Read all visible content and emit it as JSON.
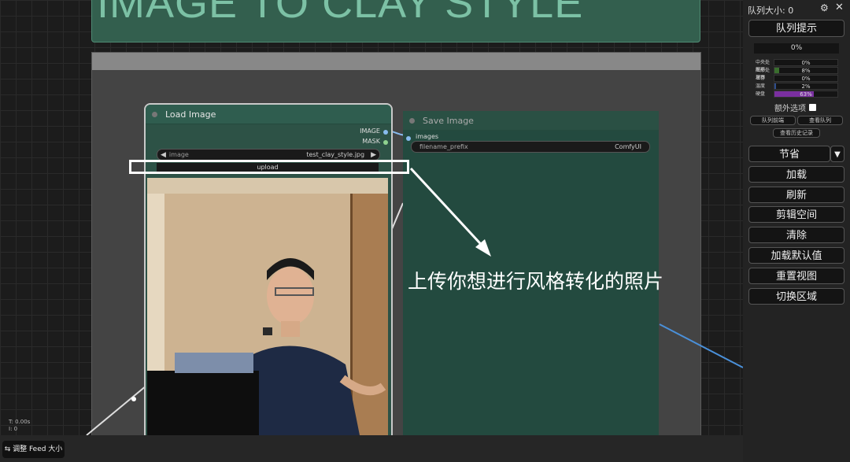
{
  "canvas": {
    "title_note": "IMAGE TO CLAY STYLE",
    "stats": [
      "T: 0.00s",
      "I: 0"
    ]
  },
  "load_node": {
    "title": "Load Image",
    "outputs": [
      {
        "label": "IMAGE",
        "color": "#88bbee"
      },
      {
        "label": "MASK",
        "color": "#8fd18f"
      }
    ],
    "image_widget": {
      "name": "image",
      "value": "test_clay_style.jpg"
    },
    "upload_label": "upload"
  },
  "save_node": {
    "title": "Save Image",
    "input": "images",
    "prefix_widget": {
      "name": "filename_prefix",
      "value": "ComfyUI"
    }
  },
  "annotation": {
    "text": "上传你想进行风格转化的照片"
  },
  "sidebar": {
    "queue_size": "队列大小: 0",
    "queue_prompt": "队列提示",
    "progress": "0%",
    "stats": [
      {
        "label": "中央处理器",
        "value": "0%",
        "fill": 0,
        "color": "#3a6e2e"
      },
      {
        "label": "图形处理器",
        "value": "8%",
        "fill": 0.08,
        "color": "#3a6e2e"
      },
      {
        "label": "显存",
        "value": "0%",
        "fill": 0,
        "color": "#2e4e8e"
      },
      {
        "label": "温度",
        "value": "2%",
        "fill": 0.02,
        "color": "#2e4e8e"
      },
      {
        "label": "硬盘",
        "value": "63%",
        "fill": 0.63,
        "color": "#7a2fa0"
      }
    ],
    "extra_options": "额外选项",
    "queue_front": "队列前端",
    "view_queue": "查看队列",
    "view_history": "查看历史记录",
    "buttons": [
      "节省",
      "加载",
      "刷新",
      "剪辑空间",
      "清除",
      "加载默认值",
      "重置视图",
      "切换区域"
    ]
  },
  "bottom": {
    "feed_button": "调整 Feed 大小"
  },
  "colors": {
    "node_body": "#2d5246",
    "link_blue": "#4a90d9",
    "sidebar_bg": "#232323"
  }
}
